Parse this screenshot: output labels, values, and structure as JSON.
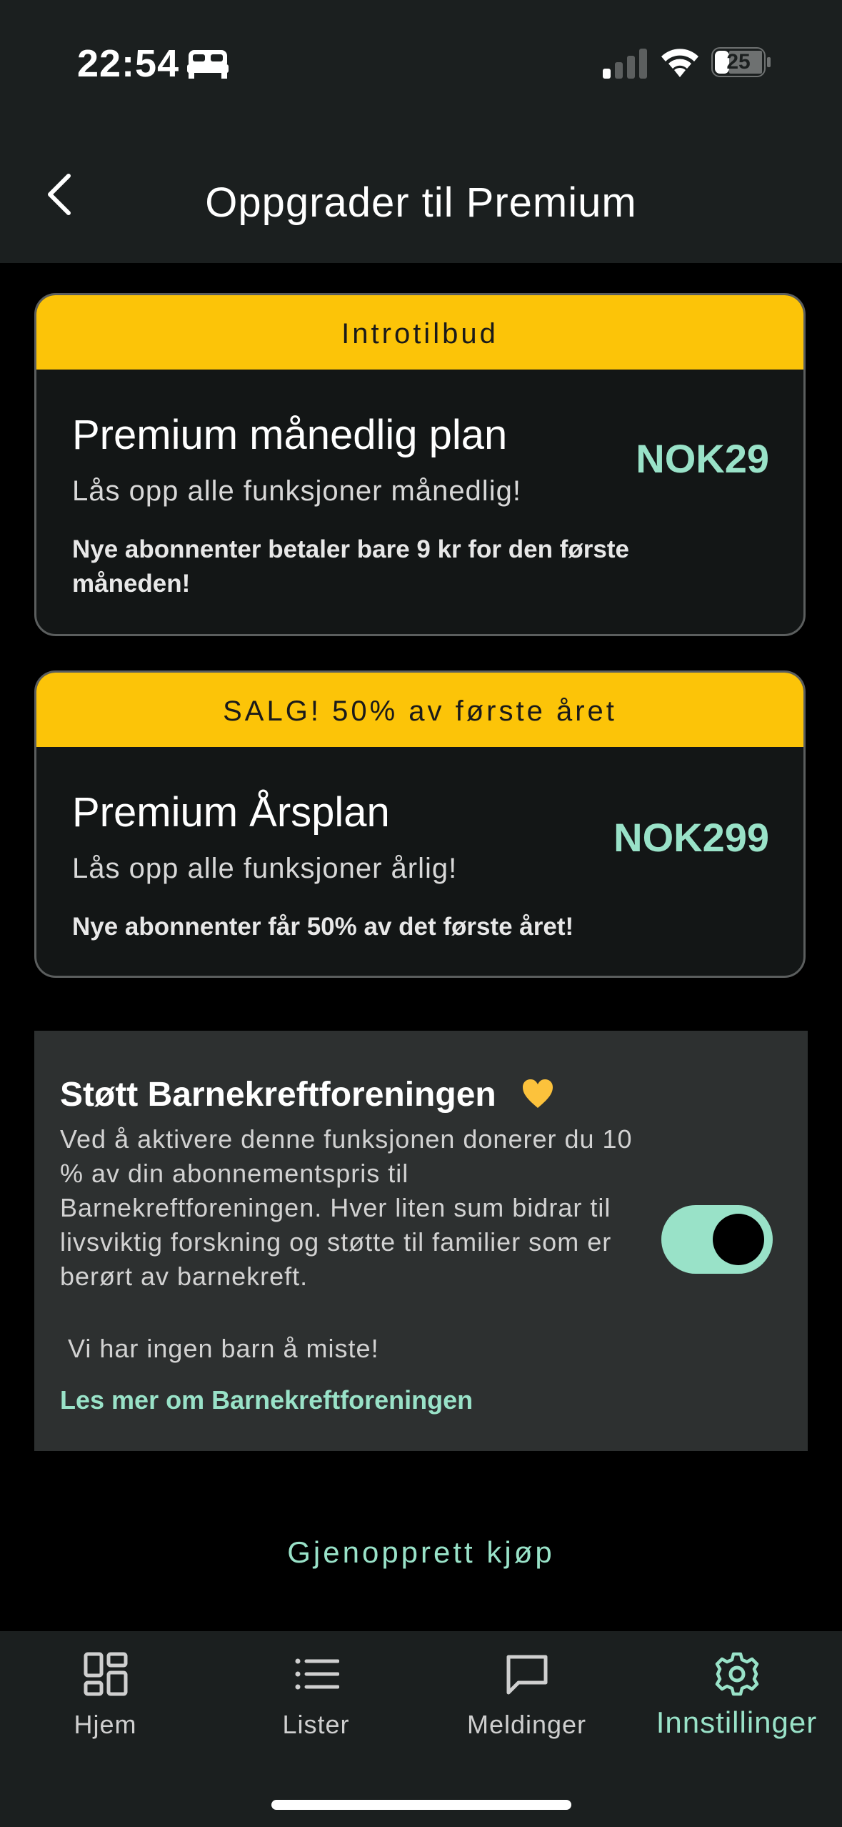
{
  "status_bar": {
    "time": "22:54",
    "battery": "25"
  },
  "header": {
    "title": "Oppgrader til Premium"
  },
  "plans": [
    {
      "badge": "Introtilbud",
      "name": "Premium månedlig plan",
      "subtitle": "Lås opp alle funksjoner månedlig!",
      "note": "Nye abonnenter betaler bare 9 kr for den første måneden!",
      "price": "NOK29"
    },
    {
      "badge": "SALG! 50% av første året",
      "name": "Premium Årsplan",
      "subtitle": "Lås opp alle funksjoner årlig!",
      "note": "Nye abonnenter får 50% av det første året!",
      "price": "NOK299"
    }
  ],
  "donate": {
    "title": "Støtt Barnekreftforeningen",
    "description": "Ved å aktivere denne funksjonen donerer du 10 % av din abonnementspris til Barnekreftforeningen. Hver liten sum bidrar til livsviktig forskning og støtte til familier som er berørt av barnekreft.",
    "tagline": " Vi har ingen barn å miste!",
    "link": "Les mer om Barnekreftforeningen",
    "enabled": true
  },
  "restore_label": "Gjenopprett kjøp",
  "tabs": [
    {
      "label": "Hjem",
      "icon": "dashboard-icon"
    },
    {
      "label": "Lister",
      "icon": "list-icon"
    },
    {
      "label": "Meldinger",
      "icon": "message-icon"
    },
    {
      "label": "Innstillinger",
      "icon": "gear-icon",
      "active": true
    }
  ],
  "colors": {
    "accent": "#99e2c8",
    "badge": "#fcc408",
    "background": "#000000",
    "bar": "#1b1f1f"
  }
}
